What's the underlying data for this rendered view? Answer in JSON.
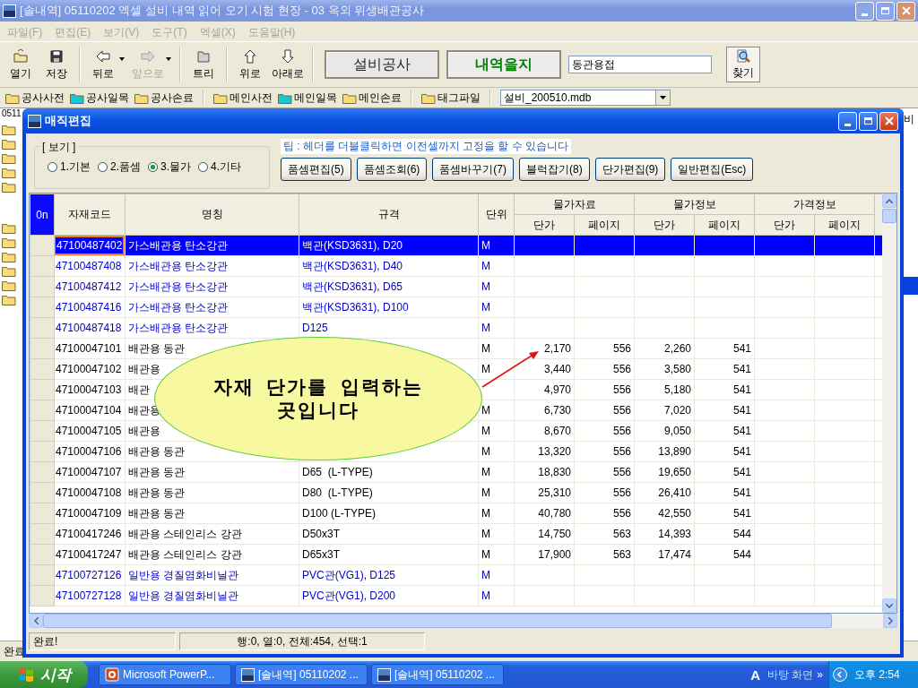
{
  "window": {
    "title": "[솔내역] 05110202 엑셀 설비 내역 읽어 오기 시험 현장 - 03 옥외 위생배관공사"
  },
  "menu": [
    {
      "label": "파일(F)",
      "disabled": true
    },
    {
      "label": "편집(E)",
      "disabled": true
    },
    {
      "label": "보기(V)",
      "disabled": true
    },
    {
      "label": "도구(T)",
      "disabled": true
    },
    {
      "label": "엑셀(X)",
      "disabled": true
    },
    {
      "label": "도움말(H)",
      "disabled": true
    }
  ],
  "toolbar": {
    "groups": [
      [
        {
          "kind": "open",
          "label": "열기",
          "disabled": false,
          "dropdown": false
        },
        {
          "kind": "save",
          "label": "저장",
          "disabled": false,
          "dropdown": false
        }
      ],
      [
        {
          "kind": "back",
          "label": "뒤로",
          "disabled": false,
          "dropdown": true
        },
        {
          "kind": "forward",
          "label": "앞으로",
          "disabled": true,
          "dropdown": true
        }
      ],
      [
        {
          "kind": "tree",
          "label": "트리",
          "disabled": false,
          "dropdown": false
        }
      ],
      [
        {
          "kind": "up",
          "label": "위로",
          "disabled": false,
          "dropdown": false
        },
        {
          "kind": "down",
          "label": "아래로",
          "disabled": false,
          "dropdown": false
        }
      ]
    ],
    "modes": [
      {
        "label": "설비공사",
        "selected": false
      },
      {
        "label": "내역을지",
        "selected": true
      }
    ],
    "search": {
      "value": "동관용접"
    },
    "find": {
      "label": "찾기"
    }
  },
  "favorites": {
    "groups": [
      [
        {
          "label": "공사사전",
          "color": "#f5dc78"
        },
        {
          "label": "공사일목",
          "color": "#19c8d8"
        },
        {
          "label": "공사손료",
          "color": "#f5dc78"
        }
      ],
      [
        {
          "label": "메인사전",
          "color": "#f5dc78"
        },
        {
          "label": "메인일목",
          "color": "#19c8d8"
        },
        {
          "label": "메인손료",
          "color": "#f5dc78"
        }
      ],
      [
        {
          "label": "태그파일",
          "color": "#f5dc78"
        }
      ]
    ],
    "database": {
      "value": "설비_200510.mdb"
    }
  },
  "background": {
    "fragment": "0511",
    "right_fragment": "비",
    "status": "완료"
  },
  "dialog": {
    "title": "매직편집",
    "view": {
      "label": "[ 보기 ]",
      "options": [
        {
          "label": "1.기본",
          "selected": false
        },
        {
          "label": "2.품셈",
          "selected": false
        },
        {
          "label": "3.물가",
          "selected": true
        },
        {
          "label": "4.기타",
          "selected": false
        }
      ]
    },
    "tip": "팁 : 헤더를 더블클릭하면 이전셀까지 고정을 할 수 있습니다",
    "buttons": [
      "품셈편집(5)",
      "품셈조회(6)",
      "품셈바꾸기(7)",
      "블럭잡기(8)",
      "단가편집(9)",
      "일반편집(Esc)"
    ],
    "table": {
      "columns": [
        "0n",
        "자재코드",
        "명칭",
        "규격",
        "단위"
      ],
      "groups": [
        {
          "label": "물가자료",
          "sub": [
            "단가",
            "페이지"
          ]
        },
        {
          "label": "물가정보",
          "sub": [
            "단가",
            "페이지"
          ]
        },
        {
          "label": "가격정보",
          "sub": [
            "단가",
            "페이지"
          ]
        }
      ],
      "rows": [
        {
          "code": "47100487402",
          "name": "가스배관용 탄소강관",
          "spec": "백관(KSD3631), D20",
          "unit": "M",
          "selected": true
        },
        {
          "code": "47100487408",
          "name": "가스배관용 탄소강관",
          "spec": "백관(KSD3631), D40",
          "unit": "M",
          "color": "#0000c8",
          "selected": false
        },
        {
          "code": "47100487412",
          "name": "가스배관용 탄소강관",
          "spec": "백관(KSD3631), D65",
          "unit": "M",
          "color": "#0000c8",
          "selected": false
        },
        {
          "code": "47100487416",
          "name": "가스배관용 탄소강관",
          "spec": "백관(KSD3631), D100",
          "unit": "M",
          "color": "#0000c8",
          "selected": false
        },
        {
          "code": "47100487418",
          "name": "가스배관용 탄소강관",
          "spec": "D125",
          "unit": "M",
          "color": "#0000c8",
          "selected": false
        },
        {
          "code": "47100047101",
          "name": "배관용 동관",
          "unit": "M",
          "color": "#000000",
          "selected": false,
          "values": [
            "2,170",
            "556",
            "2,260",
            "541"
          ]
        },
        {
          "code": "47100047102",
          "name": "배관용",
          "unit": "M",
          "color": "#000000",
          "selected": false,
          "values": [
            "3,440",
            "556",
            "3,580",
            "541"
          ]
        },
        {
          "code": "47100047103",
          "name": "배관",
          "color": "#000000",
          "selected": false,
          "values": [
            "4,970",
            "556",
            "5,180",
            "541"
          ]
        },
        {
          "code": "47100047104",
          "name": "배관용",
          "unit": "M",
          "color": "#000000",
          "selected": false,
          "values": [
            "6,730",
            "556",
            "7,020",
            "541"
          ]
        },
        {
          "code": "47100047105",
          "name": "배관용",
          "unit": "M",
          "color": "#000000",
          "selected": false,
          "values": [
            "8,670",
            "556",
            "9,050",
            "541"
          ]
        },
        {
          "code": "47100047106",
          "name": "배관용 동관",
          "unit": "M",
          "color": "#000000",
          "selected": false,
          "values": [
            "13,320",
            "556",
            "13,890",
            "541"
          ]
        },
        {
          "code": "47100047107",
          "name": "배관용 동관",
          "spec": "D65  (L-TYPE)",
          "unit": "M",
          "color": "#000000",
          "selected": false,
          "values": [
            "18,830",
            "556",
            "19,650",
            "541"
          ]
        },
        {
          "code": "47100047108",
          "name": "배관용 동관",
          "spec": "D80  (L-TYPE)",
          "unit": "M",
          "color": "#000000",
          "selected": false,
          "values": [
            "25,310",
            "556",
            "26,410",
            "541"
          ]
        },
        {
          "code": "47100047109",
          "name": "배관용 동관",
          "spec": "D100 (L-TYPE)",
          "unit": "M",
          "color": "#000000",
          "selected": false,
          "values": [
            "40,780",
            "556",
            "42,550",
            "541"
          ]
        },
        {
          "code": "47100417246",
          "name": "배관용 스테인리스 강관",
          "spec": "D50x3T",
          "unit": "M",
          "color": "#000000",
          "selected": false,
          "values": [
            "14,750",
            "563",
            "14,393",
            "544"
          ]
        },
        {
          "code": "47100417247",
          "name": "배관용 스테인리스 강관",
          "spec": "D65x3T",
          "unit": "M",
          "color": "#000000",
          "selected": false,
          "values": [
            "17,900",
            "563",
            "17,474",
            "544"
          ]
        },
        {
          "code": "47100727126",
          "name": "일반용 경질염화비닐관",
          "spec": "PVC관(VG1), D125",
          "unit": "M",
          "color": "#0000c8",
          "selected": false
        },
        {
          "code": "47100727128",
          "name": "일반용 경질염화비닐관",
          "spec": "PVC관(VG1), D200",
          "unit": "M",
          "color": "#0000c8",
          "selected": false
        }
      ]
    },
    "status": [
      "완료!",
      "행:0, 열:0, 전체:454, 선택:1"
    ]
  },
  "callout": {
    "text": "자재 단가를 입력하는 곳입니다"
  },
  "taskbar": {
    "start": "시작",
    "tasks": [
      {
        "kind": "powerpoint",
        "label": "Microsoft PowerP...",
        "selected": false
      },
      {
        "kind": "sol",
        "label": "[솔내역] 05110202 ...",
        "selected": false
      },
      {
        "kind": "sol",
        "label": "[솔내역] 05110202 ...",
        "selected": false
      }
    ],
    "ime": "A",
    "desktop": "바탕 화면",
    "more": "»",
    "clock": "오후 2:54"
  }
}
